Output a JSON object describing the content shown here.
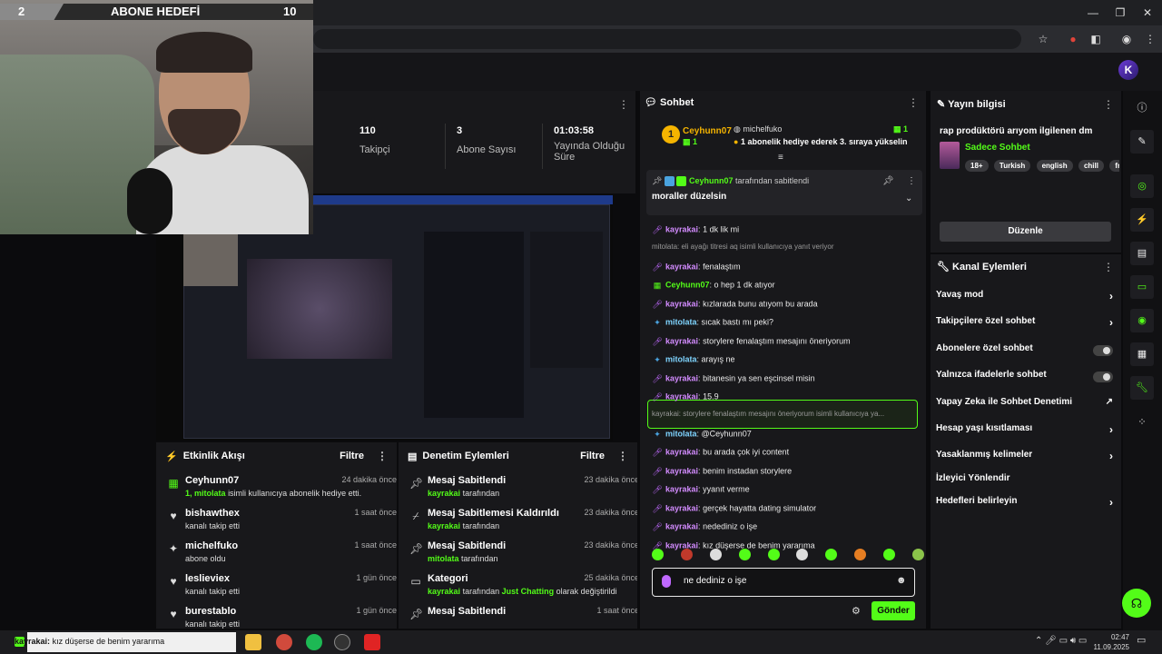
{
  "subgoal": {
    "current": "2",
    "title": "ABONE HEDEFİ",
    "target": "10",
    "progress": 0.2
  },
  "stats": [
    {
      "value": "110",
      "label": "Takipçi"
    },
    {
      "value": "3",
      "label": "Abone Sayısı"
    },
    {
      "value": "01:03:58",
      "label": "Yayında Olduğu Süre"
    }
  ],
  "activity": {
    "title": "Etkinlik Akışı",
    "filter": "Filtre",
    "items": [
      {
        "name": "Ceyhunn07",
        "time": "24 dakika önce",
        "desc_prefix": "1,",
        "desc_user": "mitolata",
        "desc_suffix": "isimli kullanıcıya abonelik hediye etti."
      },
      {
        "name": "bishawthex",
        "time": "1 saat önce",
        "desc": "kanalı takip etti"
      },
      {
        "name": "michelfuko",
        "time": "1 saat önce",
        "desc": "abone oldu"
      },
      {
        "name": "leslieviex",
        "time": "1 gün önce",
        "desc": "kanalı takip etti"
      },
      {
        "name": "burestablo",
        "time": "1 gün önce",
        "desc": "kanalı takip etti"
      }
    ]
  },
  "moderation": {
    "title": "Denetim Eylemleri",
    "filter": "Filtre",
    "items": [
      {
        "name": "Mesaj Sabitlendi",
        "time": "23 dakika önce",
        "by": "kayrakai",
        "suffix": "tarafından"
      },
      {
        "name": "Mesaj Sabitlemesi Kaldırıldı",
        "time": "23 dakika önce",
        "by": "kayrakai",
        "suffix": "tarafından"
      },
      {
        "name": "Mesaj Sabitlendi",
        "time": "23 dakika önce",
        "by": "mitolata",
        "suffix": "tarafından"
      },
      {
        "name": "Kategori",
        "time": "25 dakika önce",
        "by": "kayrakai",
        "mid": "tarafından",
        "cat": "Just Chatting",
        "suffix": "olarak değiştirildi"
      },
      {
        "name": "Mesaj Sabitlendi",
        "time": "1 saat önce",
        "by": "",
        "suffix": ""
      }
    ]
  },
  "chat": {
    "title": "Sohbet",
    "top_gifter": {
      "name": "Ceyhunn07",
      "count": "1"
    },
    "gift_user": "michelfuko",
    "gift_count": "1",
    "gift_text": "1 abonelik hediye ederek 3. sıraya yükselin",
    "pinned": {
      "by": "Ceyhunn07",
      "by_suffix": "tarafından sabitlendi",
      "text": "moraller düzelsin"
    },
    "messages": [
      {
        "user": "kayrakai",
        "text": "1 dk lik mi",
        "color": "#d38cff",
        "badge": "mic"
      },
      {
        "reply": "mitolata: eli ayağı titresi aq isimli kullanıcıya yanıt veriyor"
      },
      {
        "user": "kayrakai",
        "text": "fenalaştım",
        "color": "#d38cff",
        "badge": "mic"
      },
      {
        "user": "Ceyhunn07",
        "text": "o hep 1 dk atıyor",
        "color": "#53fc18",
        "badge": "sub"
      },
      {
        "user": "kayrakai",
        "text": "kızlarada bunu atıyom bu arada",
        "color": "#d38cff",
        "badge": "mic"
      },
      {
        "user": "mitolata",
        "text": "sıcak bastı mı peki?",
        "color": "#7fd4ff",
        "badge": "mod"
      },
      {
        "user": "kayrakai",
        "text": "storylere fenalaştım mesajını öneriyorum",
        "color": "#d38cff",
        "badge": "mic"
      },
      {
        "user": "mitolata",
        "text": "arayış ne",
        "color": "#7fd4ff",
        "badge": "mod"
      },
      {
        "user": "kayrakai",
        "text": "bitanesin ya sen eşcinsel misin",
        "color": "#d38cff",
        "badge": "mic"
      },
      {
        "user": "kayrakai",
        "text": "15.9",
        "color": "#d38cff",
        "badge": "mic"
      },
      {
        "reply": "kayrakai: storylere fenalaştım mesajını öneriyorum isimli kullanıcıya ya..."
      },
      {
        "user": "mitolata",
        "text": "@Ceyhunn07",
        "color": "#7fd4ff",
        "badge": "mod"
      },
      {
        "user": "kayrakai",
        "text": "bu arada çok iyi content",
        "color": "#d38cff",
        "badge": "mic"
      },
      {
        "user": "kayrakai",
        "text": "benim instadan storylere",
        "color": "#d38cff",
        "badge": "mic"
      },
      {
        "user": "kayrakai",
        "text": "yyanıt verme",
        "color": "#d38cff",
        "badge": "mic"
      },
      {
        "user": "kayrakai",
        "text": "gerçek hayatta dating simulator",
        "color": "#d38cff",
        "badge": "mic"
      },
      {
        "user": "kayrakai",
        "text": "nedediniz o işe",
        "color": "#d38cff",
        "badge": "mic"
      },
      {
        "user": "kayrakai",
        "text": "kız düşerse de benim yararıma",
        "color": "#d38cff",
        "badge": "mic"
      }
    ],
    "input_value": "ne dediniz o işe",
    "send_label": "Gönder"
  },
  "stream_info": {
    "header": "Yayın bilgisi",
    "title": "rap prodüktörü arıyom ilgilenen dm",
    "category": "Sadece Sohbet",
    "tags": [
      "18+",
      "Turkish",
      "english",
      "chill",
      "fr"
    ],
    "edit_label": "Düzenle"
  },
  "channel_actions": {
    "header": "Kanal Eylemleri",
    "items": [
      {
        "label": "Yavaş mod",
        "type": "chevron"
      },
      {
        "label": "Takipçilere özel sohbet",
        "type": "chevron"
      },
      {
        "label": "Abonelere özel sohbet",
        "type": "toggle"
      },
      {
        "label": "Yalnızca ifadelerle sohbet",
        "type": "toggle"
      },
      {
        "label": "Yapay Zeka ile Sohbet Denetimi",
        "type": "external"
      },
      {
        "label": "Hesap yaşı kısıtlaması",
        "type": "chevron"
      },
      {
        "label": "Yasaklanmış kelimeler",
        "type": "chevron"
      },
      {
        "label": "İzleyici Yönlendir",
        "type": "none"
      },
      {
        "label": "Hedefleri belirleyin",
        "type": "chevron"
      }
    ]
  },
  "taskbar": {
    "notif_user": "kayrakai:",
    "notif_text": "kız düşerse de benim yararıma",
    "time": "02:47",
    "date": "11.09.2025"
  },
  "colors": {
    "accent": "#53fc18",
    "panel": "#18181b",
    "bg": "#0b0b0d"
  }
}
